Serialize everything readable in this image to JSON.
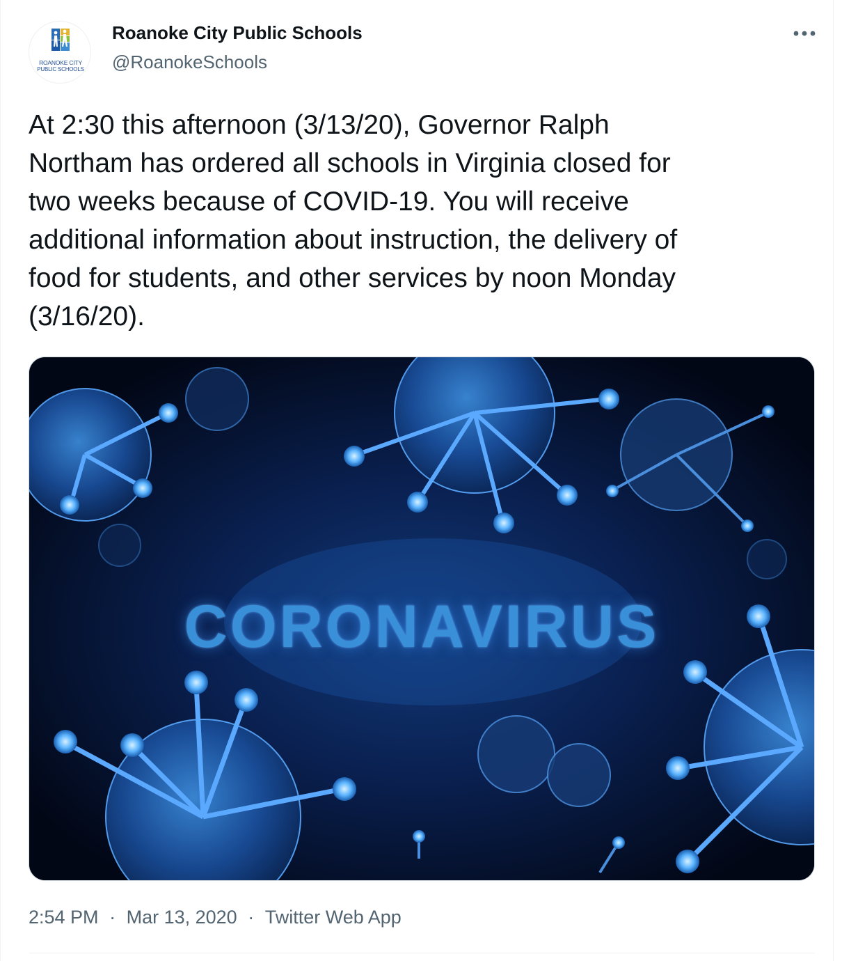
{
  "author": {
    "name": "Roanoke City Public Schools",
    "handle": "@RoanokeSchools",
    "avatar_logo_text": [
      "ROANOKE CITY",
      "PUBLIC SCHOOLS"
    ]
  },
  "more_icon": "more-horizontal-icon",
  "tweet_text": "At 2:30 this afternoon (3/13/20), Governor Ralph\nNortham has ordered all schools in Virginia closed for\ntwo weeks because of COVID-19. You will receive\nadditional information about instruction, the delivery of\nfood for students, and other services by noon Monday\n(3/16/20).",
  "media": {
    "headline": "CORONAVIRUS"
  },
  "meta": {
    "time": "2:54 PM",
    "separator": "·",
    "date": "Mar 13, 2020",
    "source": "Twitter Web App"
  },
  "colors": {
    "text_primary": "#0f1419",
    "text_secondary": "#536471",
    "media_bg": "#030a1c",
    "virus_blue": "#3a8fd9"
  }
}
